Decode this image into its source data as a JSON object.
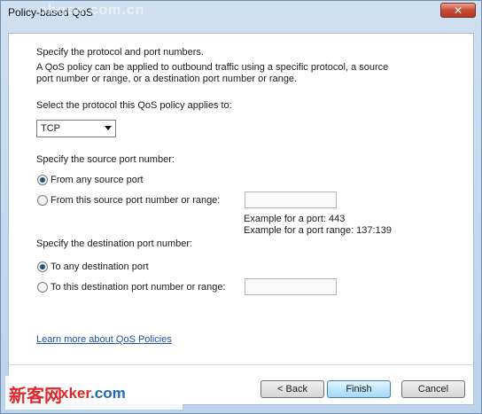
{
  "window": {
    "title": "Policy-based QoS",
    "close_symbol": "✕",
    "watermark_top": "ohqos.com.cn"
  },
  "main": {
    "heading": "Specify the protocol and port numbers.",
    "description_line1": "A QoS policy can be applied to outbound traffic using a specific protocol, a source",
    "description_line2": "port number or range, or a destination port number or range.",
    "protocol_label": "Select the protocol this QoS policy applies to:",
    "protocol_value": "TCP",
    "source_label": "Specify the source port number:",
    "source_option_any": "From any source port",
    "source_option_specific": "From this source port number or range:",
    "source_input_value": "",
    "example_port": "Example for a port: 443",
    "example_range": "Example for a port range: 137:139",
    "dest_label": "Specify the destination port number:",
    "dest_option_any": "To any destination port",
    "dest_option_specific": "To this destination port number or range:",
    "dest_input_value": "",
    "learn_more_link": "Learn more about QoS Policies"
  },
  "footer": {
    "back_label": "< Back",
    "finish_label": "Finish",
    "cancel_label": "Cancel"
  },
  "watermark": {
    "chinese": "新客网",
    "url_prefix": "xker",
    "url_suffix": ".com"
  },
  "colors": {
    "window_frame": "#bcd3ea",
    "link": "#1f4fa8",
    "close_button": "#c94c35",
    "watermark_red": "#e0272b"
  }
}
